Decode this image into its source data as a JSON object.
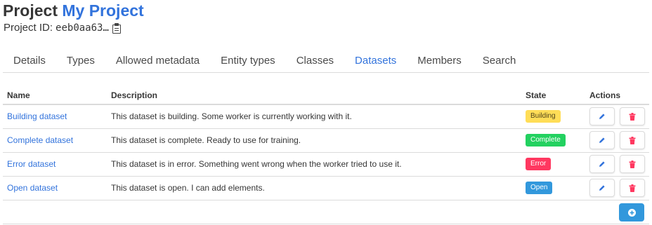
{
  "header": {
    "title_prefix": "Project",
    "project_name": "My Project",
    "project_id_label": "Project ID:",
    "project_id_value": "eeb0aa63…"
  },
  "tabs": [
    {
      "label": "Details",
      "active": false
    },
    {
      "label": "Types",
      "active": false
    },
    {
      "label": "Allowed metadata",
      "active": false
    },
    {
      "label": "Entity types",
      "active": false
    },
    {
      "label": "Classes",
      "active": false
    },
    {
      "label": "Datasets",
      "active": true
    },
    {
      "label": "Members",
      "active": false
    },
    {
      "label": "Search",
      "active": false
    }
  ],
  "table": {
    "headers": {
      "name": "Name",
      "description": "Description",
      "state": "State",
      "actions": "Actions"
    },
    "rows": [
      {
        "name": "Building dataset",
        "description": "This dataset is building. Some worker is currently working with it.",
        "state": "Building"
      },
      {
        "name": "Complete dataset",
        "description": "This dataset is complete. Ready to use for training.",
        "state": "Complete"
      },
      {
        "name": "Error dataset",
        "description": "This dataset is in error. Something went wrong when the worker tried to use it.",
        "state": "Error"
      },
      {
        "name": "Open dataset",
        "description": "This dataset is open. I can add elements.",
        "state": "Open"
      }
    ]
  },
  "icons": {
    "copy": "clipboard-icon",
    "edit": "pencil-icon",
    "delete": "trash-icon",
    "add": "plus-circle-icon"
  },
  "colors": {
    "link": "#3273dc",
    "building": "#ffdd57",
    "complete": "#23d160",
    "error": "#ff3860",
    "open": "#3298dc",
    "edit_icon": "#3273dc",
    "delete_icon": "#ff3860",
    "add_button": "#3298dc"
  }
}
